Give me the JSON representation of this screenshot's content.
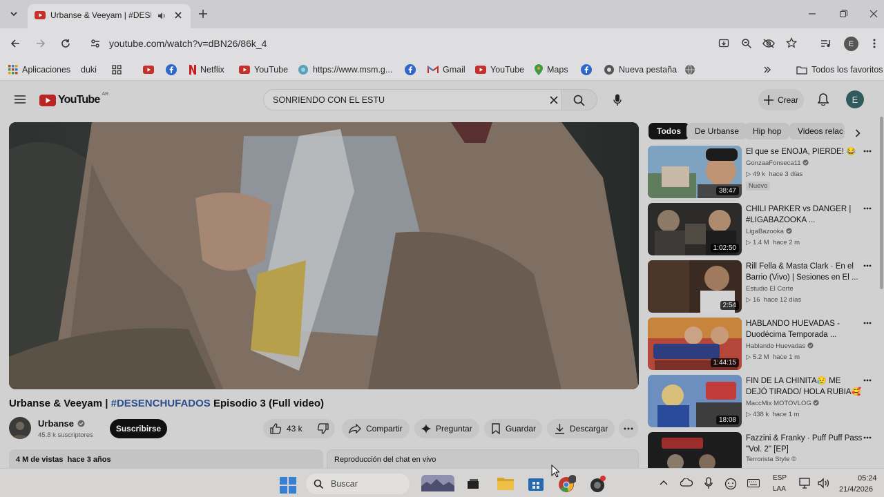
{
  "browser": {
    "tab_title": "Urbanse & Veeyam | #DESE",
    "url": "youtube.com/watch?v=dBN26/86k_4",
    "profile_letter": "E",
    "bookmarks": [
      "Aplicaciones",
      "duki",
      "Netflix",
      "YouTube",
      "https://www.msm.g...",
      "Gmail",
      "YouTube",
      "Maps",
      "Nueva pestaña"
    ],
    "all_bookmarks": "Todos los favoritos"
  },
  "youtube": {
    "logo_text": "YouTube",
    "country": "AR",
    "search_value": "SONRIENDO CON EL ESTU",
    "create_label": "Crear",
    "avatar_letter": "E",
    "video": {
      "title_pre": "Urbanse & Veeyam | ",
      "title_tag": "#DESENCHUFADOS",
      "title_post": " Episodio 3 (Full video)",
      "channel": "Urbanse",
      "subscribers": "45.8 k suscriptores",
      "subscribe_label": "Suscribirse",
      "likes": "43 k",
      "share_label": "Compartir",
      "ask_label": "Preguntar",
      "save_label": "Guardar",
      "download_label": "Descargar",
      "views_line": "4 M de vistas  hace 3 años",
      "chat_label": "Reproducción del chat en vivo"
    },
    "chips": [
      "Todos",
      "De Urbanse",
      "Hip hop",
      "Videos relac"
    ],
    "recommendations": [
      {
        "title": "El que se ENOJA, PIERDE! 😂",
        "channel": "GonzaaFonseca11",
        "stats": "49 k  hace 3 días",
        "badge": "Nuevo",
        "duration": "38:47"
      },
      {
        "title": "CHILI PARKER vs DANGER | #LIGABAZOOKA ...",
        "channel": "LigaBazooka",
        "stats": "1.4 M  hace 2 m",
        "duration": "1:02:50"
      },
      {
        "title": "Rill Fella & Masta Clark · En el Barrio (Vivo) | Sesiones en El ...",
        "channel": "Estudio El Corte",
        "stats": "16  hace 12 días",
        "duration": "2:54"
      },
      {
        "title": "HABLANDO HUEVADAS - Duodécima Temporada ...",
        "channel": "Hablando Huevadas",
        "stats": "5.2 M  hace 1 m",
        "duration": "1:44:15"
      },
      {
        "title": "FIN DE LA CHINITA😥 ME DEJÓ TIRADO/ HOLA RUBIA🥰 / ...",
        "channel": "MaccMix MOTOVLOG",
        "stats": "438 k  hace 1 m",
        "duration": "18:08"
      },
      {
        "title": "Fazzini & Franky · Puff Puff Pass \"Vol. 2\" [EP]",
        "channel": "Terrorista Style ©",
        "stats": "",
        "duration": ""
      }
    ]
  },
  "taskbar": {
    "search_placeholder": "Buscar",
    "lang_top": "ESP",
    "lang_bottom": "LAA",
    "time": "05:24",
    "date": "21/4/2026"
  }
}
